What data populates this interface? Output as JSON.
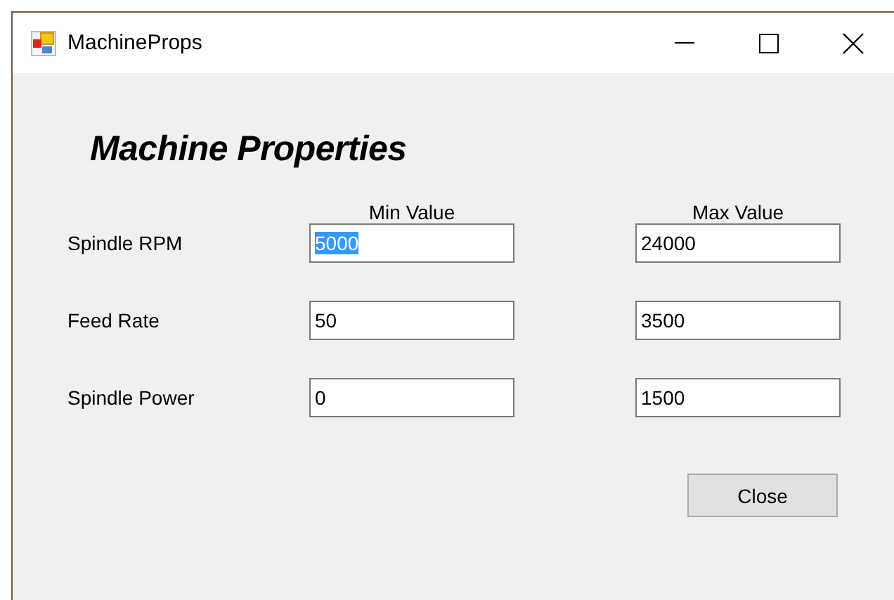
{
  "window": {
    "title": "MachineProps"
  },
  "heading": "Machine Properties",
  "columns": [
    "Min Value",
    "Max Value"
  ],
  "rows": [
    {
      "label": "Spindle RPM",
      "min": {
        "value": "5000",
        "text_selected": true
      },
      "max": {
        "value": "24000",
        "text_selected": false
      }
    },
    {
      "label": "Feed Rate",
      "min": {
        "value": "50",
        "text_selected": false
      },
      "max": {
        "value": "3500",
        "text_selected": false
      }
    },
    {
      "label": "Spindle Power",
      "min": {
        "value": "0",
        "text_selected": false
      },
      "max": {
        "value": "1500",
        "text_selected": false
      }
    }
  ],
  "buttons": [
    "Close"
  ]
}
